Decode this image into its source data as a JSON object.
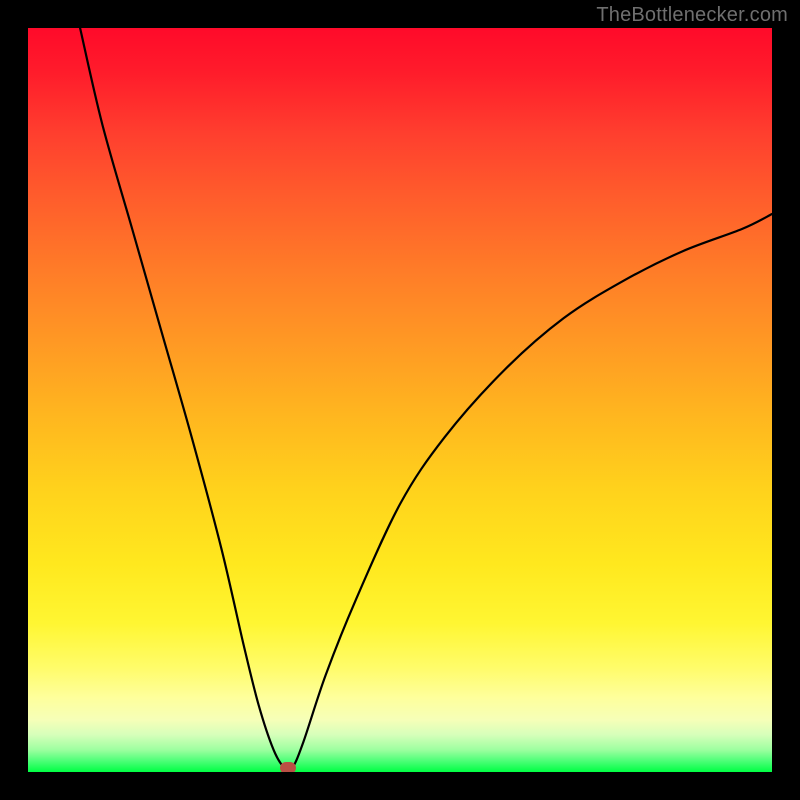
{
  "watermark": "TheBottlenecker.com",
  "chart_data": {
    "type": "line",
    "title": "",
    "xlabel": "",
    "ylabel": "",
    "xlim": [
      0,
      100
    ],
    "ylim": [
      0,
      100
    ],
    "axes_visible": false,
    "grid": false,
    "legend": false,
    "background": "gradient red→yellow→green (vertical)",
    "series": [
      {
        "name": "bottleneck-curve",
        "x": [
          7,
          10,
          14,
          18,
          22,
          26,
          29,
          31,
          33,
          34.5,
          35.5,
          37,
          40,
          44,
          50,
          56,
          64,
          72,
          80,
          88,
          96,
          100
        ],
        "y": [
          100,
          87,
          73,
          59,
          45,
          30,
          17,
          9,
          3,
          0.5,
          0.5,
          4,
          13,
          23,
          36,
          45,
          54,
          61,
          66,
          70,
          73,
          75
        ],
        "color": "#000000",
        "stroke_width": 2
      }
    ],
    "marker": {
      "series": "bottleneck-curve",
      "x": 35,
      "y": 0.5,
      "shape": "rounded-rect",
      "color": "#ba4f44"
    },
    "frame": {
      "border_color": "#000000",
      "border_width": 28
    }
  }
}
